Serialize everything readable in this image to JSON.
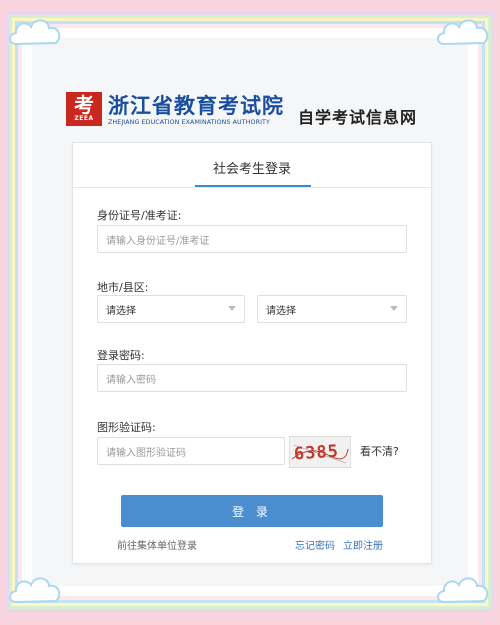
{
  "header": {
    "logo_char": "考",
    "logo_abbr": "ZEEA",
    "org_name": "浙江省教育考试院",
    "org_name_en": "ZHEJIANG EDUCATION EXAMINATIONS AUTHORITY",
    "site_name": "自学考试信息网"
  },
  "login": {
    "title": "社会考生登录",
    "id_label": "身份证号/准考证:",
    "id_placeholder": "请输入身份证号/准考证",
    "region_label": "地市/县区:",
    "city_select": "请选择",
    "county_select": "请选择",
    "password_label": "登录密码:",
    "password_placeholder": "请输入密码",
    "captcha_label": "图形验证码:",
    "captcha_placeholder": "请输入图形验证码",
    "captcha_code": "6385",
    "captcha_refresh": "看不清?",
    "submit": "登 录",
    "group_login_link": "前往集体单位登录",
    "forgot_link": "忘记密码",
    "register_link": "立即注册"
  },
  "colors": {
    "accent": "#4a8ed0",
    "brand": "#1a4fa0",
    "logo_red": "#c8281e",
    "background": "#f9d3dd"
  }
}
